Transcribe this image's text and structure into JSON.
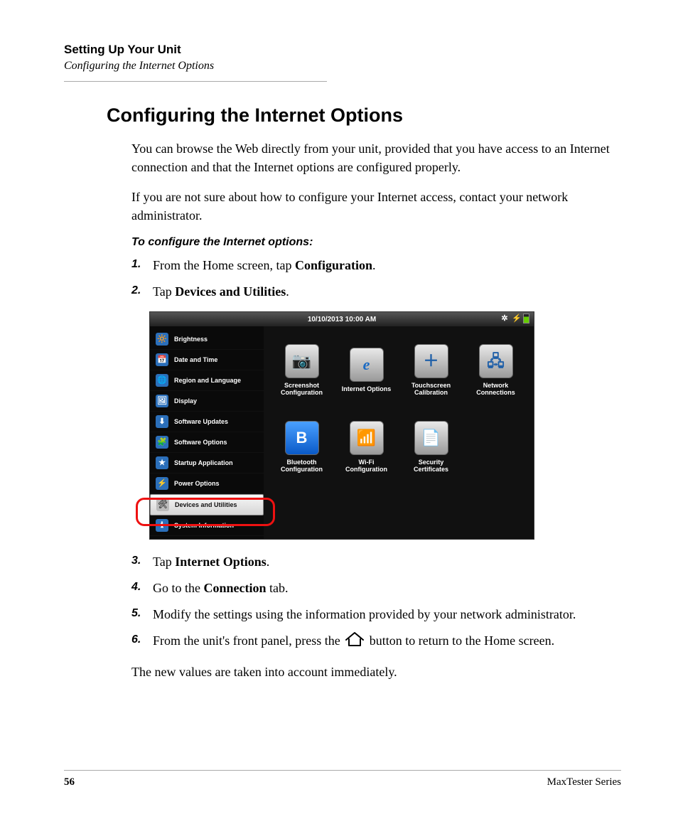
{
  "header": {
    "title": "Setting Up Your Unit",
    "subtitle": "Configuring the Internet Options"
  },
  "main": {
    "title": "Configuring the Internet Options",
    "para1": "You can browse the Web directly from your unit, provided that you have access to an Internet connection and that the Internet options are configured properly.",
    "para2": "If you are not sure about how to configure your Internet access, contact your network administrator.",
    "subhead": "To configure the Internet options:",
    "steps": {
      "s1_pre": "From the Home screen, tap ",
      "s1_b": "Configuration",
      "s1_post": ".",
      "s2_pre": "Tap ",
      "s2_b": "Devices and Utilities",
      "s2_post": ".",
      "s3_pre": "Tap ",
      "s3_b": "Internet Options",
      "s3_post": ".",
      "s4_pre": "Go to the ",
      "s4_b": "Connection",
      "s4_post": " tab.",
      "s5": "Modify the settings using the information provided by your network administrator.",
      "s6_pre": "From the unit's front panel, press the ",
      "s6_post": " button to return to the Home screen."
    },
    "closing": "The new values are taken into account immediately."
  },
  "device": {
    "datetime": "10/10/2013 10:00 AM",
    "sidebar": [
      "Brightness",
      "Date and Time",
      "Region and Language",
      "Display",
      "Software Updates",
      "Software Options",
      "Startup Application",
      "Power Options",
      "Devices and Utilities",
      "System Information"
    ],
    "apps": [
      {
        "label": "Screenshot Configuration",
        "glyph": "📷"
      },
      {
        "label": "Internet Options",
        "glyph": "e"
      },
      {
        "label": "Touchscreen Calibration",
        "glyph": "＋"
      },
      {
        "label": "Network Connections",
        "glyph": "🖧"
      },
      {
        "label": "Bluetooth Configuration",
        "glyph": "B"
      },
      {
        "label": "Wi-Fi Configuration",
        "glyph": "📶"
      },
      {
        "label": "Security Certificates",
        "glyph": "📄"
      }
    ],
    "sidebar_icons": [
      "🔆",
      "📅",
      "🌐",
      "🖼",
      "⬇",
      "🧩",
      "★",
      "⚡",
      "🛠",
      "ℹ"
    ]
  },
  "footer": {
    "page": "56",
    "series": "MaxTester Series"
  },
  "nums": {
    "n1": "1.",
    "n2": "2.",
    "n3": "3.",
    "n4": "4.",
    "n5": "5.",
    "n6": "6."
  }
}
